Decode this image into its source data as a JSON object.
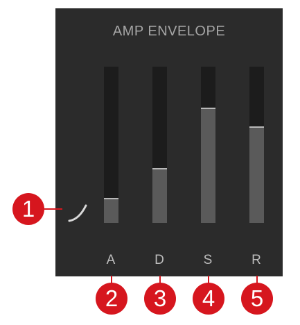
{
  "panel": {
    "title": "AMP ENVELOPE"
  },
  "sliders": [
    {
      "id": "attack",
      "label": "A",
      "value": 0.16
    },
    {
      "id": "decay",
      "label": "D",
      "value": 0.35
    },
    {
      "id": "sustain",
      "label": "S",
      "value": 0.74
    },
    {
      "id": "release",
      "label": "R",
      "value": 0.62
    }
  ],
  "callouts": [
    "1",
    "2",
    "3",
    "4",
    "5"
  ],
  "icons": {
    "curve": "attack-curve-icon"
  },
  "colors": {
    "panel_bg": "#2b2b2b",
    "slider_track": "#1c1c1c",
    "slider_fill": "#5a5a5a",
    "slider_cap": "#b8b8b8",
    "callout": "#d6161e"
  }
}
